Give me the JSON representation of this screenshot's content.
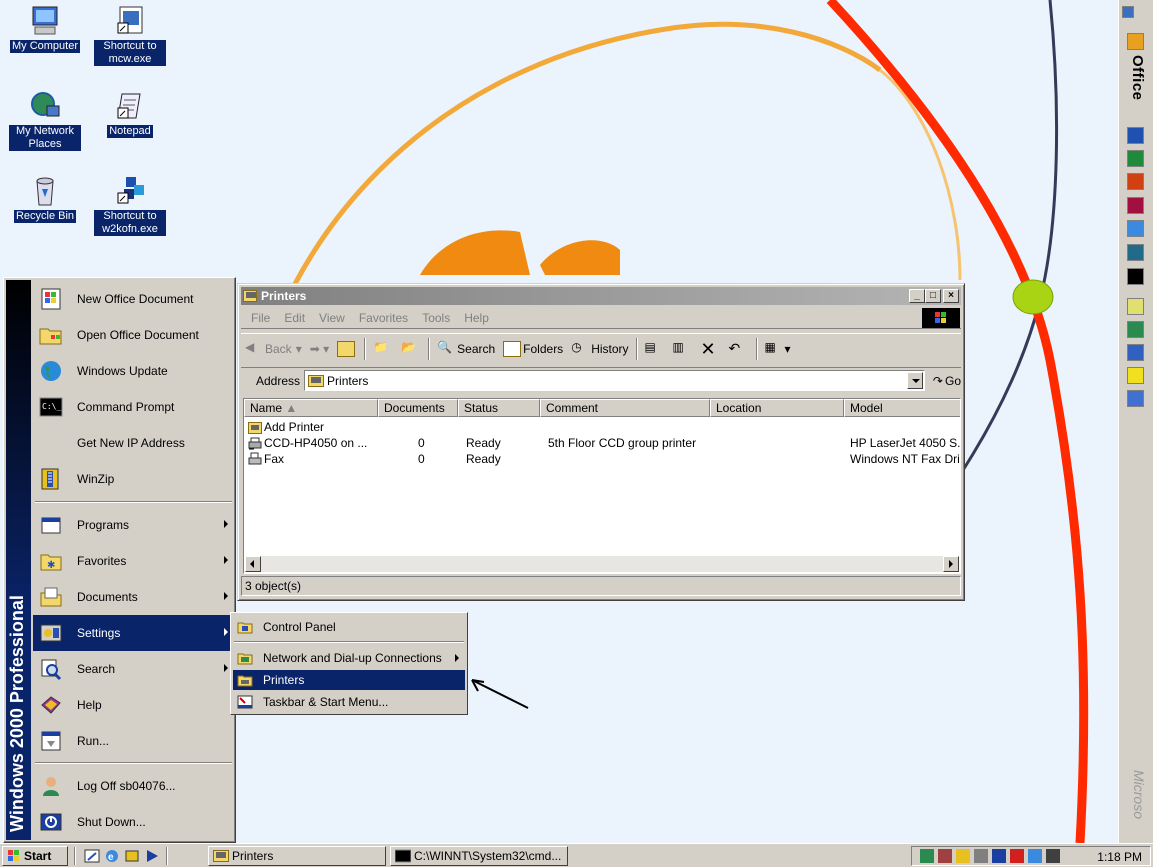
{
  "desktop": {
    "icons": [
      {
        "label": "My Computer"
      },
      {
        "label": "Shortcut to mcw.exe"
      },
      {
        "label": "My Network Places"
      },
      {
        "label": "Notepad"
      },
      {
        "label": "Recycle Bin"
      },
      {
        "label": "Shortcut to w2kofn.exe"
      }
    ]
  },
  "office_bar": {
    "label": "Office",
    "footer": "Microso"
  },
  "start_menu": {
    "banner": "Windows 2000 Professional",
    "items": [
      {
        "label": "New Office Document",
        "icon": "office-new-icon"
      },
      {
        "label": "Open Office Document",
        "icon": "office-open-icon"
      },
      {
        "label": "Windows Update",
        "icon": "globe-icon"
      },
      {
        "label": "Command Prompt",
        "icon": "command-prompt-icon"
      },
      {
        "label": "Get New IP Address",
        "icon": "network-icon"
      },
      {
        "label": "WinZip",
        "icon": "winzip-icon"
      },
      {
        "label": "Programs",
        "icon": "programs-icon"
      },
      {
        "label": "Favorites",
        "icon": "favorites-icon"
      },
      {
        "label": "Documents",
        "icon": "documents-icon"
      },
      {
        "label": "Settings",
        "icon": "settings-icon"
      },
      {
        "label": "Search",
        "icon": "search-icon"
      },
      {
        "label": "Help",
        "icon": "help-icon"
      },
      {
        "label": "Run...",
        "icon": "run-icon"
      },
      {
        "label": "Log Off sb04076...",
        "icon": "logoff-icon"
      },
      {
        "label": "Shut Down...",
        "icon": "shutdown-icon"
      }
    ]
  },
  "settings_menu": {
    "items": [
      {
        "label": "Control Panel"
      },
      {
        "label": "Network and Dial-up Connections"
      },
      {
        "label": "Printers"
      },
      {
        "label": "Taskbar & Start Menu..."
      }
    ]
  },
  "window": {
    "title": "Printers",
    "menu": [
      "File",
      "Edit",
      "View",
      "Favorites",
      "Tools",
      "Help"
    ],
    "toolbar": {
      "back": "Back",
      "search": "Search",
      "folders": "Folders",
      "history": "History"
    },
    "address_label": "Address",
    "address_value": "Printers",
    "go_label": "Go",
    "columns": [
      "Name",
      "Documents",
      "Status",
      "Comment",
      "Location",
      "Model"
    ],
    "rows": [
      {
        "name": "Add Printer",
        "documents": "",
        "status": "",
        "comment": "",
        "location": "",
        "model": ""
      },
      {
        "name": "CCD-HP4050 on ...",
        "documents": "0",
        "status": "Ready",
        "comment": "5th Floor CCD group printer",
        "location": "",
        "model": "HP LaserJet 4050 S."
      },
      {
        "name": "Fax",
        "documents": "0",
        "status": "Ready",
        "comment": "",
        "location": "",
        "model": "Windows NT Fax Dri"
      }
    ],
    "status_text": "3 object(s)"
  },
  "taskbar": {
    "start_label": "Start",
    "tasks": [
      {
        "label": "Printers"
      },
      {
        "label": "C:\\WINNT\\System32\\cmd..."
      }
    ],
    "clock": "1:18 PM"
  },
  "colors": {
    "selection": "#0a246a",
    "face": "#d4d0c8",
    "desktop": "#ebf3fc"
  }
}
